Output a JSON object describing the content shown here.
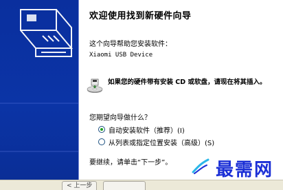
{
  "wizard": {
    "title": "欢迎使用找到新硬件向导",
    "intro": "这个向导帮助您安装软件：",
    "device_name": "Xiaomi USB Device",
    "cd_notice": "如果您的硬件带有安装 CD 或软盘，请现在将其插入。",
    "question": "您期望向导做什么？",
    "options": [
      {
        "label": "自动安装软件（推荐）(I)",
        "selected": true
      },
      {
        "label": "从列表或指定位置安装（高级）(S)",
        "selected": false
      }
    ],
    "continue_text": "要继续，请单击“下一步”。"
  },
  "footer": {
    "back_label": "< 上一步"
  },
  "watermark": {
    "text": "最需网"
  },
  "colors": {
    "side_panel": "#0b34a6",
    "watermark": "#1b2fd6",
    "radio_dot": "#21a121"
  },
  "icons": {
    "side_panel": "hardware-graphic-icon",
    "cd": "cd-disc-icon",
    "watermark": "watermark-logo-icon"
  }
}
